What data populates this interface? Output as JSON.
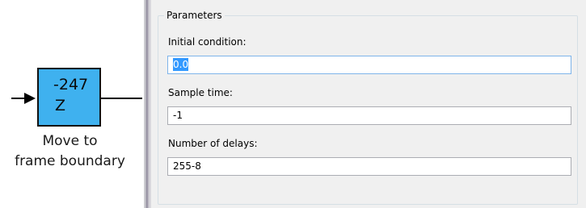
{
  "block": {
    "delay_value": "-247",
    "variable": "Z",
    "caption_line1": "Move to",
    "caption_line2": "frame boundary",
    "fill_color": "#3fb1ef"
  },
  "parameters": {
    "group_title": "Parameters",
    "fields": [
      {
        "label": "Initial condition:",
        "value": "0.0",
        "focused": true,
        "selected": true
      },
      {
        "label": "Sample time:",
        "value": "-1"
      },
      {
        "label": "Number of delays:",
        "value": "255-8"
      }
    ]
  }
}
